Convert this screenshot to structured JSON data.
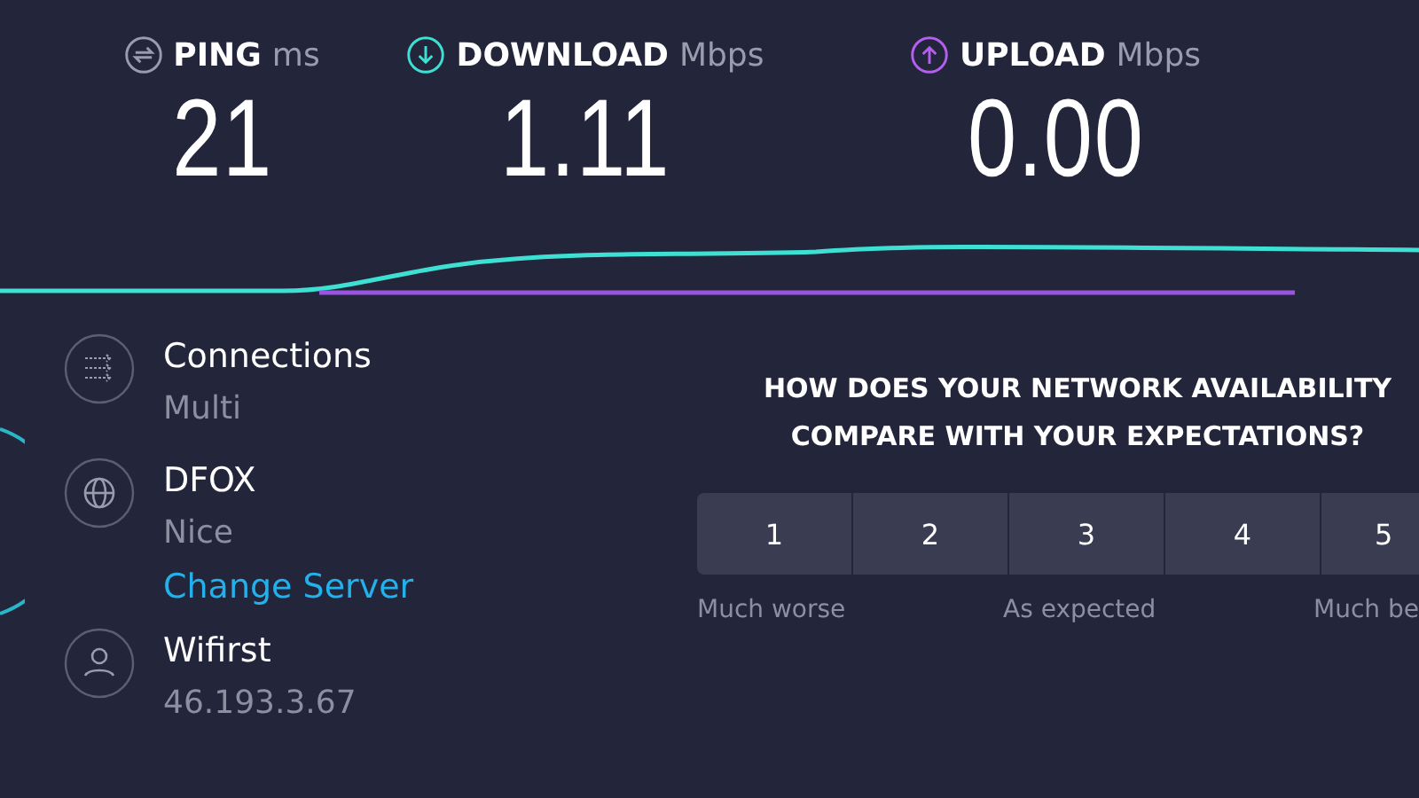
{
  "metrics": [
    {
      "kind": "ping",
      "label": "PING",
      "unit": "ms",
      "value": "21"
    },
    {
      "kind": "download",
      "label": "DOWNLOAD",
      "unit": "Mbps",
      "value": "1.11"
    },
    {
      "kind": "upload",
      "label": "UPLOAD",
      "unit": "Mbps",
      "value": "0.00"
    }
  ],
  "details": [
    {
      "kind": "connections",
      "title": "Connections",
      "subtitle": "Multi"
    },
    {
      "kind": "server",
      "title": "DFOX",
      "subtitle": "Nice",
      "link": "Change Server"
    },
    {
      "kind": "provider",
      "title": "Wifirst",
      "subtitle": "46.193.3.67"
    }
  ],
  "survey": {
    "question": [
      "HOW DOES YOUR NETWORK AVAILABILITY",
      "COMPARE WITH YOUR EXPECTATIONS?"
    ],
    "options": [
      {
        "label": "1",
        "selected": false
      },
      {
        "label": "2",
        "selected": false
      },
      {
        "label": "3",
        "selected": false
      },
      {
        "label": "4",
        "selected": false
      },
      {
        "label": "5",
        "selected": false
      }
    ],
    "scale_labels": [
      "Much worse",
      "As expected",
      "Much be"
    ]
  }
}
